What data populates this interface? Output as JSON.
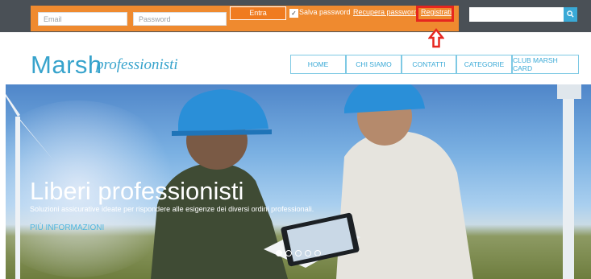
{
  "login": {
    "email_placeholder": "Email",
    "password_placeholder": "Password",
    "submit_label": "Entra",
    "remember_label": "Salva password",
    "recover_link": "Recupera password",
    "register_link": "Registrati"
  },
  "search": {
    "placeholder": "",
    "icon": "search-icon"
  },
  "logo": {
    "main": "Marsh",
    "sub": "professionisti"
  },
  "nav": {
    "items": [
      {
        "label": "HOME"
      },
      {
        "label": "CHI SIAMO"
      },
      {
        "label": "CONTATTI"
      },
      {
        "label": "CATEGORIE"
      },
      {
        "label": "CLUB MARSH CARD"
      }
    ]
  },
  "hero": {
    "title": "Liberi professionisti",
    "subtitle": "Soluzioni assicurative ideate per rispondere alle esigenze dei diversi ordini professionali.",
    "link": "PIÙ INFORMAZIONI",
    "slides_total": 5,
    "active_slide": 1
  },
  "colors": {
    "topbar": "#4a5056",
    "login_bar": "#ef8a2f",
    "accent": "#37a3cc",
    "highlight": "#e6261f"
  }
}
